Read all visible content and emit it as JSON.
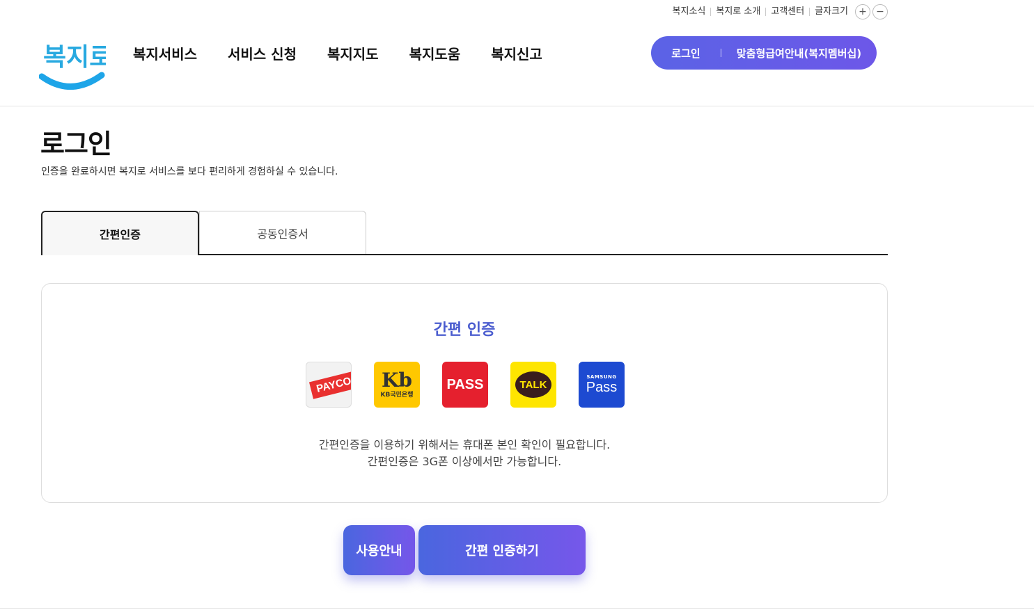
{
  "util": {
    "items": [
      "복지소식",
      "복지로 소개",
      "고객센터",
      "글자크기"
    ],
    "font_plus": "+",
    "font_minus": "−"
  },
  "header": {
    "logo_text": "복지로",
    "nav": [
      "복지서비스",
      "서비스 신청",
      "복지지도",
      "복지도움",
      "복지신고"
    ],
    "login_label": "로그인",
    "member_label": "맞춤형급여안내(복지멤버십)"
  },
  "page": {
    "title": "로그인",
    "description": "인증을 완료하시면 복지로 서비스를 보다 편리하게 경험하실 수 있습니다."
  },
  "tabs": [
    {
      "label": "간편인증",
      "active": true
    },
    {
      "label": "공동인증서",
      "active": false
    }
  ],
  "auth": {
    "title": "간편 인증",
    "providers": {
      "payco": "PAYCO",
      "kb_mark": "Kb",
      "kb_text": "KB국민은행",
      "pass": "PASS",
      "talk": "TALK",
      "samsung_top": "SAMSUNG",
      "samsung_main": "Pass"
    },
    "desc_line1": "간편인증을 이용하기 위해서는 휴대폰 본인 확인이 필요합니다.",
    "desc_line2": "간편인증은 3G폰 이상에서만 가능합니다."
  },
  "buttons": {
    "guide": "사용안내",
    "auth": "간편 인증하기"
  },
  "colors": {
    "accent": "#5b63e6",
    "auth_title": "#4a5ccf"
  }
}
